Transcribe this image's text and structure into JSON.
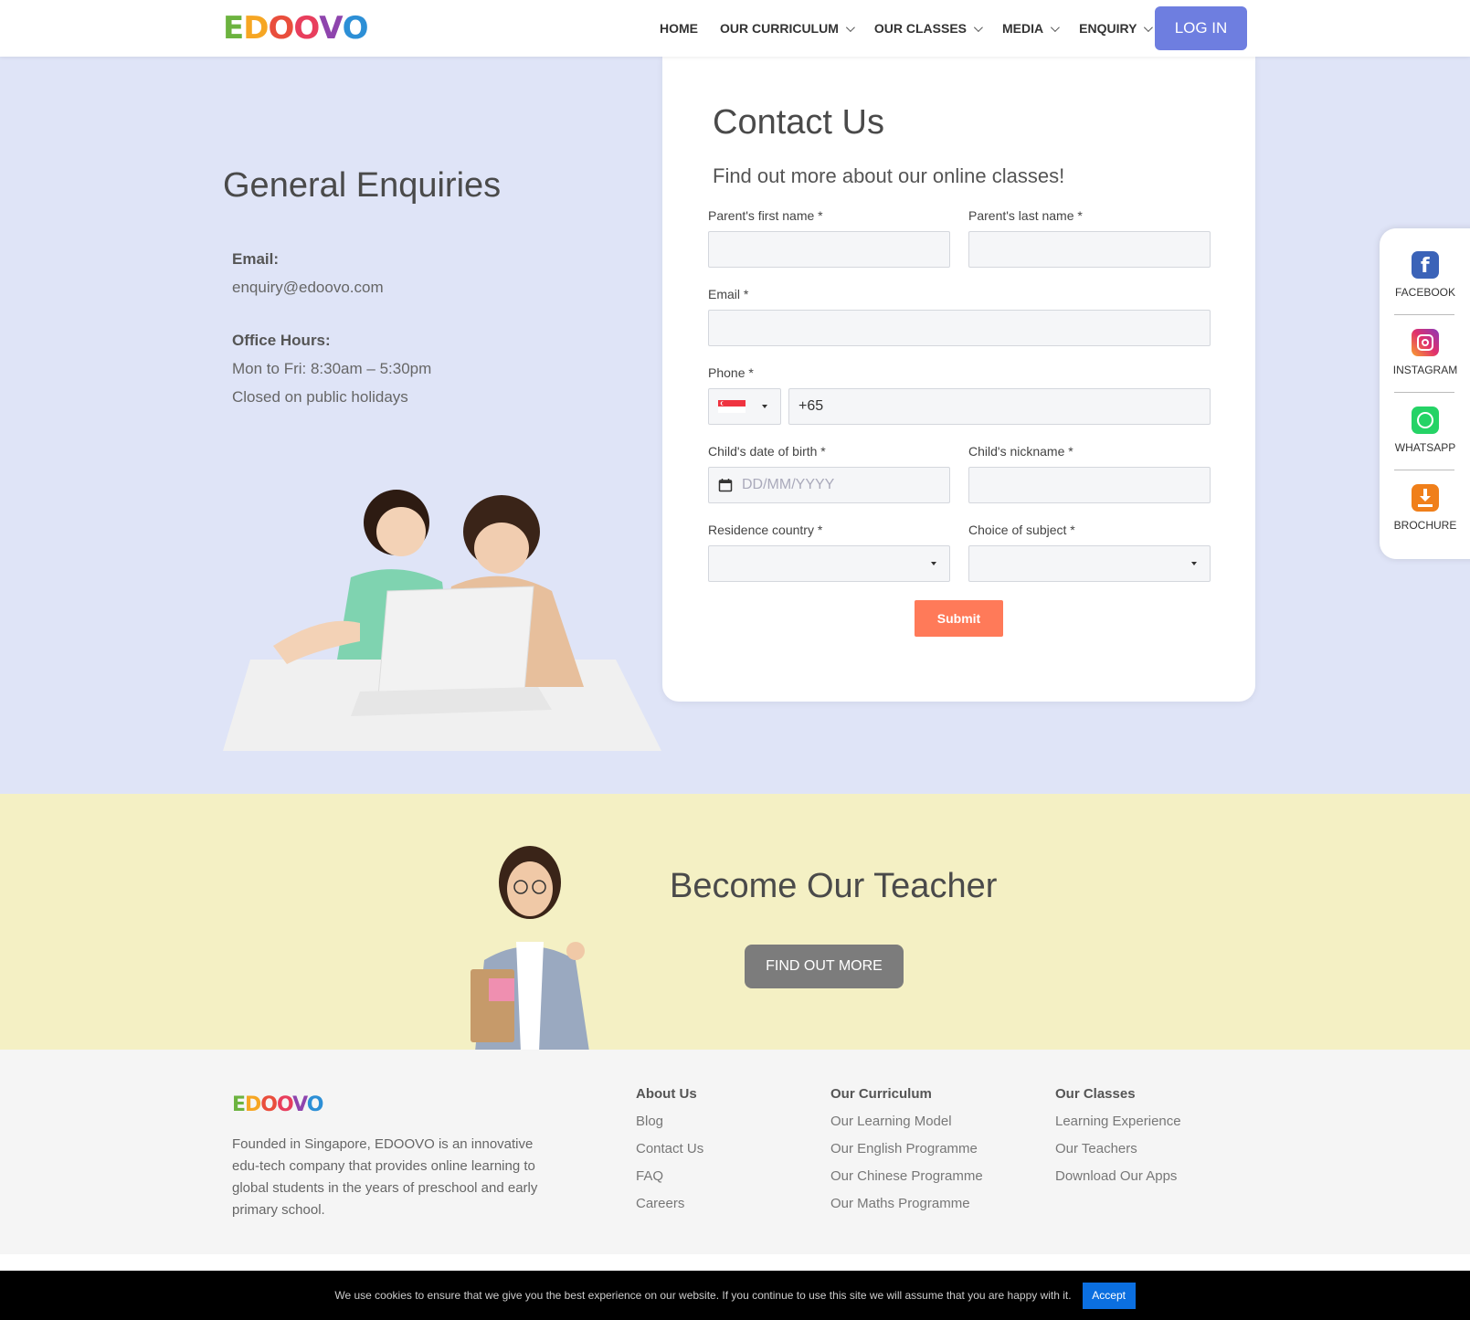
{
  "header": {
    "logo_letters": [
      "E",
      "D",
      "O",
      "O",
      "V",
      "O"
    ],
    "nav": [
      {
        "label": "HOME",
        "has_dropdown": false
      },
      {
        "label": "OUR CURRICULUM",
        "has_dropdown": true
      },
      {
        "label": "OUR CLASSES",
        "has_dropdown": true
      },
      {
        "label": "MEDIA",
        "has_dropdown": true
      },
      {
        "label": "ENQUIRY",
        "has_dropdown": true
      }
    ],
    "login_label": "LOG IN"
  },
  "enquiries": {
    "title": "General Enquiries",
    "email_label": "Email:",
    "email_value": "enquiry@edoovo.com",
    "hours_label": "Office Hours:",
    "hours_line1": "Mon to Fri: 8:30am – 5:30pm",
    "hours_line2": "Closed on public holidays"
  },
  "contact_form": {
    "title": "Contact Us",
    "subtitle": "Find out more about our online classes!",
    "first_name_label": "Parent's first name *",
    "last_name_label": "Parent's last name *",
    "email_label": "Email *",
    "phone_label": "Phone *",
    "phone_value": "+65",
    "dob_label": "Child's date of birth *",
    "dob_placeholder": "DD/MM/YYYY",
    "nickname_label": "Child's nickname *",
    "country_label": "Residence country *",
    "subject_label": "Choice of subject *",
    "submit_label": "Submit"
  },
  "social": [
    {
      "label": "FACEBOOK",
      "icon": "facebook-icon",
      "color": "#3b63b8"
    },
    {
      "label": "INSTAGRAM",
      "icon": "instagram-icon",
      "color": "#e1306c"
    },
    {
      "label": "WHATSAPP",
      "icon": "whatsapp-icon",
      "color": "#25d366"
    },
    {
      "label": "BROCHURE",
      "icon": "download-icon",
      "color": "#f07f1a"
    }
  ],
  "teacher": {
    "title": "Become Our Teacher",
    "button_label": "FIND OUT MORE"
  },
  "footer": {
    "description": "Founded in Singapore, EDOOVO is an innovative edu-tech company that provides online learning to global students in the years of preschool and early primary school.",
    "about": {
      "heading": "About Us",
      "links": [
        "Blog",
        "Contact Us",
        "FAQ",
        "Careers"
      ]
    },
    "curriculum": {
      "heading": "Our Curriculum",
      "links": [
        "Our Learning Model",
        "Our English Programme",
        "Our Chinese Programme",
        "Our Maths Programme"
      ]
    },
    "classes": {
      "heading": "Our Classes",
      "links": [
        "Learning Experience",
        "Our Teachers",
        "Download Our Apps"
      ]
    }
  },
  "cookie": {
    "text": "We use cookies to ensure that we give you the best experience on our website. If you continue to use this site we will assume that you are happy with it.",
    "accept_label": "Accept"
  },
  "colors": {
    "brand_purple": "#6e7ee0",
    "submit_orange": "#ff7a59",
    "enquiry_bg": "#dfe4f7",
    "teacher_bg": "#f4f0c4"
  }
}
